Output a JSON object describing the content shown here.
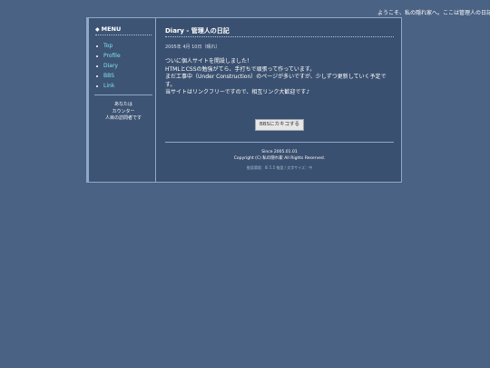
{
  "marquee": {
    "text": "ようこそ、私の隠れ家へ。ここは管理人の日記"
  },
  "sidebar": {
    "menu_title": "MENU",
    "items": [
      {
        "label": "Top"
      },
      {
        "label": "Profile"
      },
      {
        "label": "Diary"
      },
      {
        "label": "BBS"
      },
      {
        "label": "Link"
      }
    ],
    "counter": {
      "line1": "あなたは",
      "image_alt": "カウンター",
      "line2": "人目の訪問者です"
    }
  },
  "main": {
    "title": "Diary - 管理人の日記",
    "date": "2005年 4月 10日（晴れ）",
    "lines": [
      "ついに個人サイトを開設しました！",
      "HTMLとCSSの勉強がてら、手打ちで頑張って作っています。",
      "まだ工事中（Under Construction）のページが多いですが、少しずつ更新していく予定です。",
      "当サイトはリンクフリーですので、相互リンク大歓迎です♪"
    ],
    "bbs_button_label": "BBSにカキコする"
  },
  "footer": {
    "since": "Since 2005.01.01",
    "copyright": "Copyright (C) 私の隠れ家 All Rights Reserved.",
    "recommended": "推奨環境：IE 5.5 推奨 / 文字サイズ：中"
  },
  "colors": {
    "background": "#4a6284",
    "panel": "#3a5070",
    "sidebar": "#3d5474",
    "link": "#7fe3f0",
    "border": "#8fa9c8"
  }
}
